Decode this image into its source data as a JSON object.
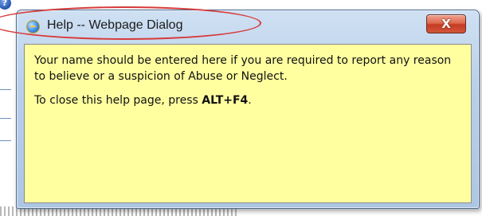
{
  "background": {
    "help_icon_glyph": "?"
  },
  "dialog": {
    "title": "Help -- Webpage Dialog",
    "title_icon": "ie-browser-icon",
    "close_label": "X",
    "body": {
      "paragraph_1": "Your name should be entered here if you are required to report any reason to believe or a suspicion of Abuse or Neglect.",
      "paragraph_2_prefix": "To close this help page, press ",
      "paragraph_2_keys": "ALT+F4",
      "paragraph_2_suffix": "."
    }
  },
  "colors": {
    "content_background": "#ffffa0",
    "highlight_ellipse": "#d73a3a",
    "close_button": "#c43b22"
  }
}
